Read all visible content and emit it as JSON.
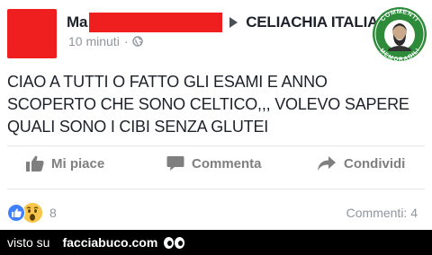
{
  "post": {
    "author_visible": "Ma",
    "group": "CELIACHIA ITALIA",
    "time": "10 minuti",
    "meta_separator": "·",
    "text_lines": [
      "CIAO A TUTTI O FATTO GLI ESAMI E ANNO",
      "SCOPERTO CHE SONO CELTICO,,, VOLEVO SAPERE",
      "QUALI SONO I CIBI SENZA GLUTEI"
    ]
  },
  "logo": {
    "top_text": "COMMENTI",
    "bottom_text": "MEMORABILI"
  },
  "actions": {
    "like_label": "Mi piace",
    "comment_label": "Commenta",
    "share_label": "Condividi"
  },
  "stats": {
    "reactions_count": "8",
    "comments": "Commenti: 4"
  },
  "watermark": {
    "prefix": "visto su",
    "site": "facciabuco.com"
  },
  "colors": {
    "redaction": "#ef1f1f",
    "like_blue": "#4080ff",
    "wow_yellow": "#f7c64a",
    "logo_green": "#2e8b3a",
    "action_gray": "#7f7f7f"
  },
  "icons": {
    "audience": "globe-icon",
    "like": "thumbs-up-icon",
    "comment": "comment-bubble-icon",
    "share": "share-arrow-icon"
  }
}
